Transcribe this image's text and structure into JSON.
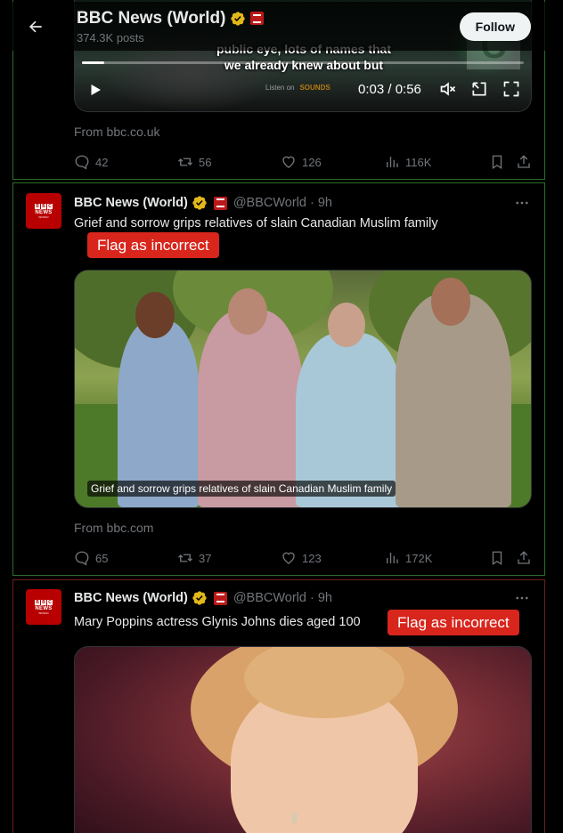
{
  "header": {
    "title": "BBC News (World)",
    "posts_count": "374.3K posts",
    "follow_label": "Follow"
  },
  "tweets": [
    {
      "video": {
        "caption_line1": "public eye, lots of names that",
        "caption_line2": "we already knew about but",
        "time": "0:03 / 0:56",
        "sounds_prefix": "Listen on",
        "sounds_label": "SOUNDS",
        "progress": 0.05,
        "overlay_letter": "C"
      },
      "source": "From bbc.co.uk",
      "replies": "42",
      "reposts": "56",
      "likes": "126",
      "views": "116K"
    },
    {
      "name": "BBC News (World)",
      "handle": "@BBCWorld",
      "time": "· 9h",
      "text": "Grief and sorrow grips relatives of slain Canadian Muslim family",
      "flag_label": "Flag as incorrect",
      "image_caption": "Grief and sorrow grips relatives of slain Canadian Muslim family",
      "source": "From bbc.com",
      "replies": "65",
      "reposts": "37",
      "likes": "123",
      "views": "172K"
    },
    {
      "name": "BBC News (World)",
      "handle": "@BBCWorld",
      "time": "· 9h",
      "text": "Mary Poppins actress Glynis Johns dies aged 100",
      "flag_label": "Flag as incorrect"
    }
  ],
  "avatar": {
    "letters": [
      "B",
      "B",
      "C"
    ],
    "line1": "NEWS",
    "line2": "WORLD"
  },
  "colors": {
    "background": "#000000",
    "verified_gold": "#e2b719",
    "flag_red": "#d8261d",
    "bbc_red": "#b80000",
    "muted_text": "#71767b"
  }
}
